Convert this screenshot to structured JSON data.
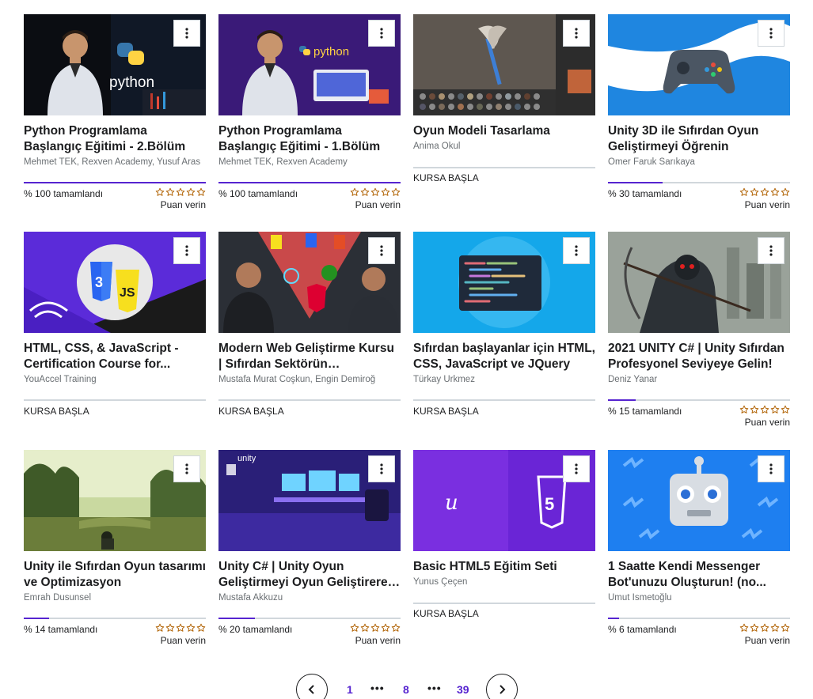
{
  "courses": [
    {
      "title": "Python Programlama Başlangıç Eğitimi - 2.Bölüm",
      "author": "Mehmet TEK, Rexven Academy, Yusuf Aras",
      "status": "progress",
      "progress_text": "% 100 tamamlandı",
      "progress_pct": 100,
      "rate_label": "Puan verin",
      "thumb_icon": "python-thumbnail"
    },
    {
      "title": "Python Programlama Başlangıç Eğitimi - 1.Bölüm",
      "author": "Mehmet TEK, Rexven Academy",
      "status": "progress",
      "progress_text": "% 100 tamamlandı",
      "progress_pct": 100,
      "rate_label": "Puan verin",
      "thumb_icon": "python-thumbnail"
    },
    {
      "title": "Oyun Modeli Tasarlama",
      "author": "Anima Okul",
      "status": "start",
      "start_text": "KURSA BAŞLA",
      "thumb_icon": "3d-axe-model-thumbnail"
    },
    {
      "title": "Unity 3D ile Sıfırdan Oyun Geliştirmeyi Öğrenin",
      "author": "Ömer Faruk Sarıkaya",
      "status": "progress",
      "progress_text": "% 30 tamamlandı",
      "progress_pct": 30,
      "rate_label": "Puan verin",
      "thumb_icon": "gamepad-thumbnail"
    },
    {
      "title": "HTML, CSS, & JavaScript - Certification Course for...",
      "author": "YouAccel Training",
      "status": "start",
      "start_text": "KURSA BAŞLA",
      "thumb_icon": "html-js-logos-thumbnail"
    },
    {
      "title": "Modern Web Geliştirme Kursu | Sıfırdan Sektörün Yükseklerine",
      "author": "Mustafa Murat Coşkun, Engin Demiroğ",
      "status": "start",
      "start_text": "KURSA BAŞLA",
      "thumb_icon": "web-tech-logos-thumbnail"
    },
    {
      "title": "Sıfırdan başlayanlar için HTML, CSS, JavaScript ve JQuery",
      "author": "Türkay Ürkmez",
      "status": "start",
      "start_text": "KURSA BAŞLA",
      "thumb_icon": "code-editor-thumbnail"
    },
    {
      "title": "2021 UNITY C# | Unity Sıfırdan Profesyonel Seviyeye Gelin!",
      "author": "Deniz Yanar",
      "status": "progress",
      "progress_text": "% 15 tamamlandı",
      "progress_pct": 15,
      "rate_label": "Puan verin",
      "thumb_icon": "soldier-thumbnail"
    },
    {
      "title": "Unity ile Sıfırdan Oyun tasarımı ve Optimizasyon",
      "author": "Emrah Dusunsel",
      "status": "progress",
      "progress_text": "% 14 tamamlandı",
      "progress_pct": 14,
      "rate_label": "Puan verin",
      "thumb_icon": "forest-scene-thumbnail"
    },
    {
      "title": "Unity C# | Unity Oyun Geliştirmeyi Oyun Geliştirerek Öğrenin",
      "author": "Mustafa Akkuzu",
      "status": "progress",
      "progress_text": "% 20 tamamlandı",
      "progress_pct": 20,
      "rate_label": "Puan verin",
      "thumb_icon": "unity-room-thumbnail"
    },
    {
      "title": "Basic HTML5 Eğitim Seti",
      "author": "Yunus Çeçen",
      "status": "start",
      "start_text": "KURSA BAŞLA",
      "thumb_icon": "html5-logo-thumbnail"
    },
    {
      "title": "1 Saatte Kendi Messenger Bot'unuzu Oluşturun! (no...",
      "author": "Umut İsmetoğlu",
      "status": "progress",
      "progress_text": "% 6 tamamlandı",
      "progress_pct": 6,
      "rate_label": "Puan verin",
      "thumb_icon": "robot-thumbnail"
    }
  ],
  "pagination": {
    "first": "1",
    "ellipsis": "•••",
    "current": "8",
    "last": "39",
    "prev_icon": "chevron-left-icon",
    "next_icon": "chevron-right-icon"
  },
  "colors": {
    "accent": "#5624d0",
    "track": "#d1d7dc",
    "star": "#b4690e",
    "text": "#1c1d1f",
    "muted": "#6a6f73"
  }
}
